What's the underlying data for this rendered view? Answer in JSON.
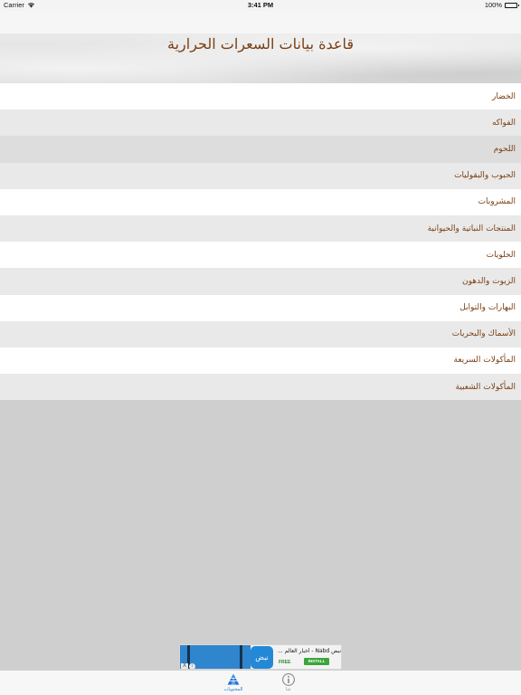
{
  "status_bar": {
    "carrier": "Carrier",
    "time": "3:41 PM",
    "battery": "100%"
  },
  "header": {
    "title": "قاعدة بيانات السعرات الحرارية"
  },
  "categories": [
    {
      "label": "الخضار"
    },
    {
      "label": "الفواكه"
    },
    {
      "label": "اللحوم"
    },
    {
      "label": "الحبوب والبقوليات"
    },
    {
      "label": "المشروبات"
    },
    {
      "label": "المنتجات النباتية والحيوانية"
    },
    {
      "label": "الحلويات"
    },
    {
      "label": "الزيوت والدهون"
    },
    {
      "label": "البهارات والتوابل"
    },
    {
      "label": "الأسماك والبحريات"
    },
    {
      "label": "المأكولات السريعة"
    },
    {
      "label": "المأكولات الشعبية"
    }
  ],
  "ad": {
    "app_icon_text": "نبض",
    "title": "نبض Nabd - أخبار العالم ...",
    "price": "FREE",
    "install_label": "INSTALL",
    "close_label": "X",
    "info_label": "i"
  },
  "tab_bar": {
    "tabs": [
      {
        "label": "المحتويات",
        "icon": "pyramid-icon",
        "active": true
      },
      {
        "label": "عنا",
        "icon": "info-icon",
        "active": false
      }
    ]
  },
  "colors": {
    "accent": "#1f74d4",
    "title_brown": "#7a3f14",
    "row_white": "#ffffff",
    "row_light": "#e9e9e9",
    "row_mid": "#dddddd",
    "background": "#cfcfcf"
  }
}
